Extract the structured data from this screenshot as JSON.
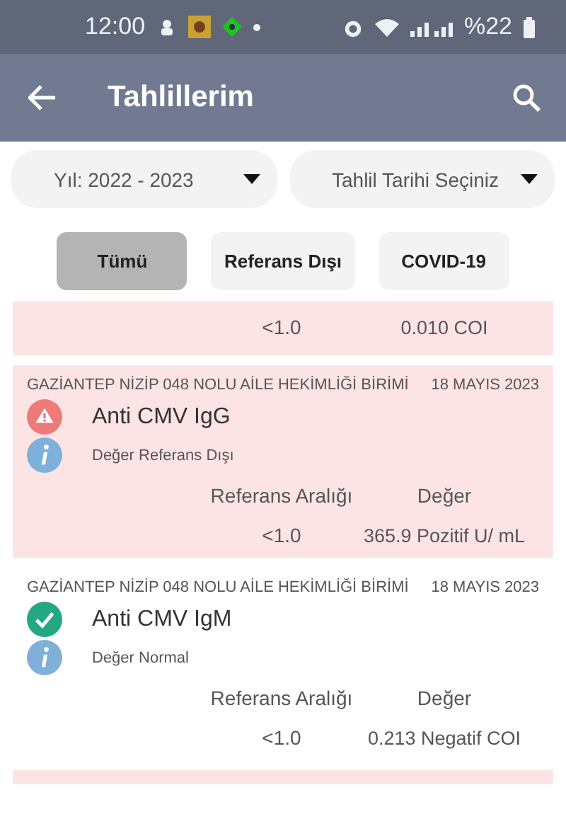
{
  "status_bar": {
    "time": "12:00",
    "battery": "%22"
  },
  "app_bar": {
    "title": "Tahlillerim"
  },
  "dropdowns": [
    {
      "label": "Yıl: 2022 - 2023"
    },
    {
      "label": "Tahlil Tarihi Seçiniz"
    }
  ],
  "filters": [
    {
      "label": "Tümü",
      "selected": true
    },
    {
      "label": "Referans Dışı",
      "selected": false
    },
    {
      "label": "COVID-19",
      "selected": false
    }
  ],
  "partial_result": {
    "out_of_range": true,
    "reference": "<1.0",
    "value": "0.010 COI"
  },
  "results": [
    {
      "institution": "GAZİANTEP NİZİP 048 NOLU AİLE HEKİMLİĞİ BİRİMİ",
      "date": "18 MAYIS 2023",
      "test": "Anti CMV IgG",
      "out_of_range": true,
      "note": "Değer Referans Dışı",
      "reference_header": "Referans Aralığı",
      "value_header": "Değer",
      "reference": "<1.0",
      "value": "365.9 Pozitif U/ mL"
    },
    {
      "institution": "GAZİANTEP NİZİP 048 NOLU AİLE HEKİMLİĞİ BİRİMİ",
      "date": "18 MAYIS 2023",
      "test": "Anti CMV IgM",
      "out_of_range": false,
      "note": "Değer Normal",
      "reference_header": "Referans Aralığı",
      "value_header": "Değer",
      "reference": "<1.0",
      "value": "0.213 Negatif COI"
    }
  ]
}
